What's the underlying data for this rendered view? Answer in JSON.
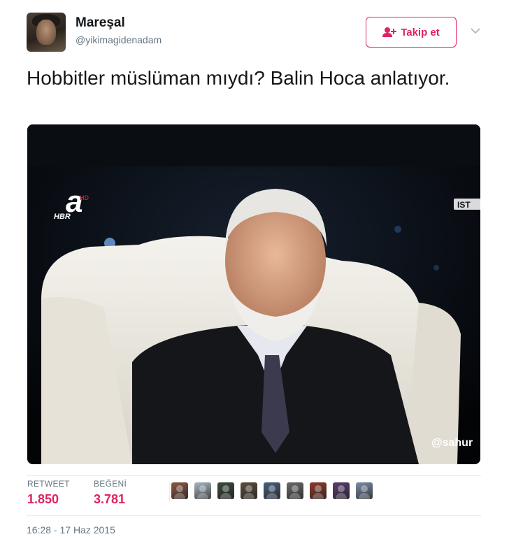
{
  "user": {
    "display_name": "Mareşal",
    "handle": "@yikimagidenadam",
    "avatar_icon": "profile-photo"
  },
  "follow_button": {
    "label": "Takip et",
    "icon": "add-user-icon",
    "color": "#e0245e"
  },
  "menu_caret_icon": "chevron-down-icon",
  "tweet": {
    "text": "Hobbitler müslüman mıydı? Balin Hoca anlatıyor."
  },
  "media": {
    "description_icon": "tv-screenshot-image",
    "overlays": {
      "channel_logo": "a",
      "channel_badge": "HD",
      "channel_sub": "HBR",
      "corner_tag": "IST",
      "watermark": "@sahur"
    }
  },
  "stats": {
    "retweet_label": "RETWEET",
    "retweet_count": "1.850",
    "like_label": "BEĞENİ",
    "like_count": "3.781"
  },
  "likers": [
    {
      "name": "liker-avatar-1",
      "color": "#8a5a44"
    },
    {
      "name": "liker-avatar-2",
      "color": "#aab8c2"
    },
    {
      "name": "liker-avatar-3",
      "color": "#3c4a3a"
    },
    {
      "name": "liker-avatar-4",
      "color": "#5e4e3c"
    },
    {
      "name": "liker-avatar-5",
      "color": "#4a5f7e"
    },
    {
      "name": "liker-avatar-6",
      "color": "#6b6b6b"
    },
    {
      "name": "liker-avatar-7",
      "color": "#8c3c2c"
    },
    {
      "name": "liker-avatar-8",
      "color": "#5b3d6e"
    },
    {
      "name": "liker-avatar-9",
      "color": "#7a8ea8"
    }
  ],
  "timestamp": "16:28 - 17 Haz 2015",
  "colors": {
    "accent": "#e0245e",
    "muted": "#657786",
    "divider": "#e6ecf0"
  }
}
